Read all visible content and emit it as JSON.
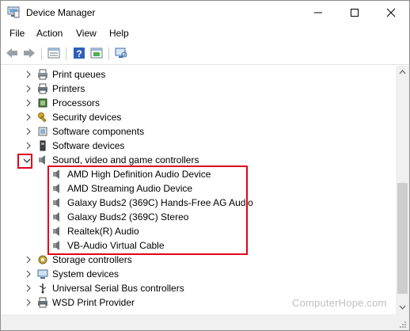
{
  "window": {
    "title": "Device Manager"
  },
  "menu": {
    "items": [
      "File",
      "Action",
      "View",
      "Help"
    ]
  },
  "tree": {
    "rows_before": [
      "Print queues",
      "Printers",
      "Processors",
      "Security devices",
      "Software components",
      "Software devices"
    ],
    "expanded_category": "Sound, video and game controllers",
    "children": [
      "AMD High Definition Audio Device",
      "AMD Streaming Audio Device",
      "Galaxy Buds2 (369C) Hands-Free AG Audio",
      "Galaxy Buds2 (369C) Stereo",
      "Realtek(R) Audio",
      "VB-Audio Virtual Cable"
    ],
    "rows_after": [
      "Storage controllers",
      "System devices",
      "Universal Serial Bus controllers",
      "WSD Print Provider"
    ]
  },
  "watermark": "ComputerHope.com",
  "colors": {
    "highlight": "#e0001b"
  }
}
